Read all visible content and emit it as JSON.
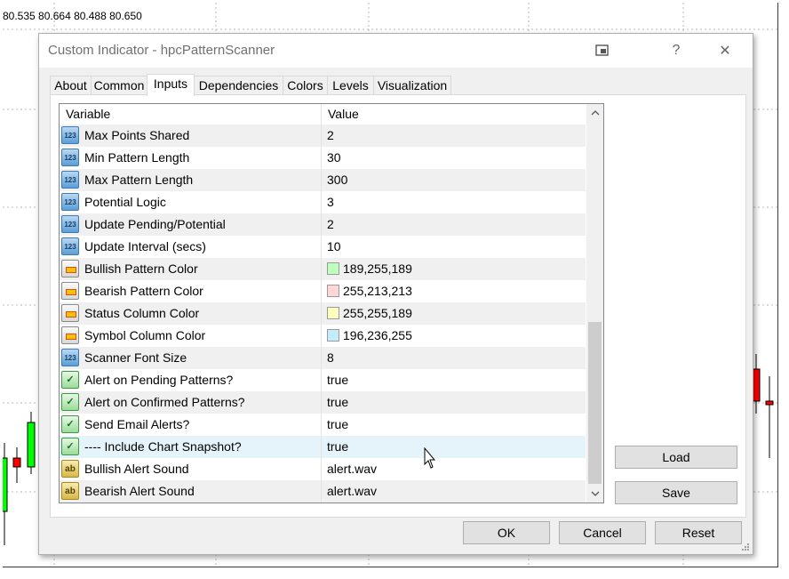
{
  "chart": {
    "quote": "80.535 80.664 80.488 80.650"
  },
  "dialog": {
    "title": "Custom Indicator - hpcPatternScanner",
    "help_glyph": "?",
    "close_glyph": "✕",
    "tabs": [
      {
        "label": "About"
      },
      {
        "label": "Common"
      },
      {
        "label": "Inputs"
      },
      {
        "label": "Dependencies"
      },
      {
        "label": "Colors"
      },
      {
        "label": "Levels"
      },
      {
        "label": "Visualization"
      }
    ],
    "active_tab": "Inputs",
    "grid": {
      "headers": {
        "variable": "Variable",
        "value": "Value"
      },
      "rows": [
        {
          "type": "int",
          "variable": "Max Points Shared",
          "value": "2"
        },
        {
          "type": "int",
          "variable": "Min Pattern Length",
          "value": "30"
        },
        {
          "type": "int",
          "variable": "Max Pattern Length",
          "value": "300"
        },
        {
          "type": "int",
          "variable": "Potential Logic",
          "value": "3"
        },
        {
          "type": "int",
          "variable": "Update Pending/Potential",
          "value": "2"
        },
        {
          "type": "int",
          "variable": "Update Interval (secs)",
          "value": "10"
        },
        {
          "type": "color",
          "variable": "Bullish Pattern Color",
          "value": "189,255,189",
          "swatch": "#bdffbd"
        },
        {
          "type": "color",
          "variable": "Bearish Pattern Color",
          "value": "255,213,213",
          "swatch": "#ffd5d5"
        },
        {
          "type": "color",
          "variable": "Status Column Color",
          "value": "255,255,189",
          "swatch": "#ffffbd"
        },
        {
          "type": "color",
          "variable": "Symbol Column Color",
          "value": "196,236,255",
          "swatch": "#c4ecff"
        },
        {
          "type": "int",
          "variable": "Scanner Font Size",
          "value": "8"
        },
        {
          "type": "bool",
          "variable": "Alert on Pending Patterns?",
          "value": "true"
        },
        {
          "type": "bool",
          "variable": "Alert on Confirmed Patterns?",
          "value": "true"
        },
        {
          "type": "bool",
          "variable": "Send Email Alerts?",
          "value": "true"
        },
        {
          "type": "bool",
          "variable": "---- Include Chart Snapshot?",
          "value": "true"
        },
        {
          "type": "string",
          "variable": "Bullish Alert Sound",
          "value": "alert.wav"
        },
        {
          "type": "string",
          "variable": "Bearish Alert Sound",
          "value": "alert.wav"
        }
      ],
      "highlighted_row": 14
    },
    "buttons": {
      "load": "Load",
      "save": "Save",
      "ok": "OK",
      "cancel": "Cancel",
      "reset": "Reset"
    },
    "icon_text": {
      "int": "123",
      "bool": "✓",
      "string": "ab"
    }
  }
}
